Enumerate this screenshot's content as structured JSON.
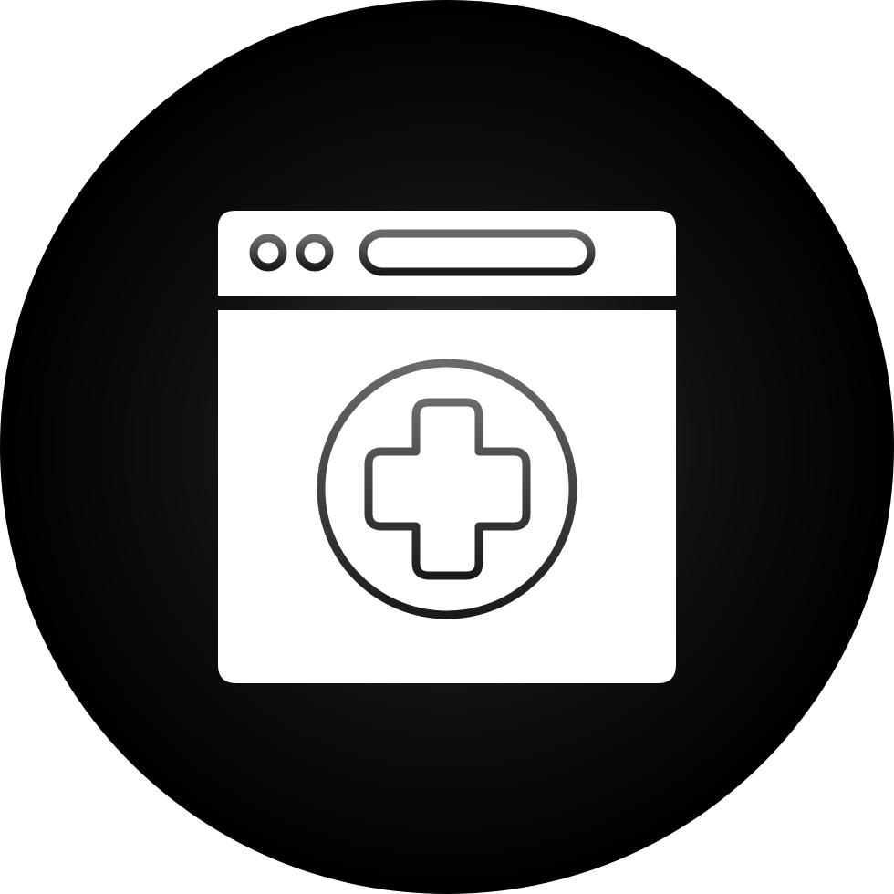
{
  "icon": {
    "semantic": "medical-website-icon",
    "elements": [
      "browser-window-icon",
      "medical-cross-icon",
      "add-tab-plus-icon"
    ]
  },
  "colors": {
    "background_circle_center": "#3a3a3a",
    "background_circle_edge": "#000000",
    "glyph_fill": "#ffffff",
    "glyph_stroke_light": "#6a6a6a",
    "glyph_stroke_dark": "#1a1a1a"
  }
}
